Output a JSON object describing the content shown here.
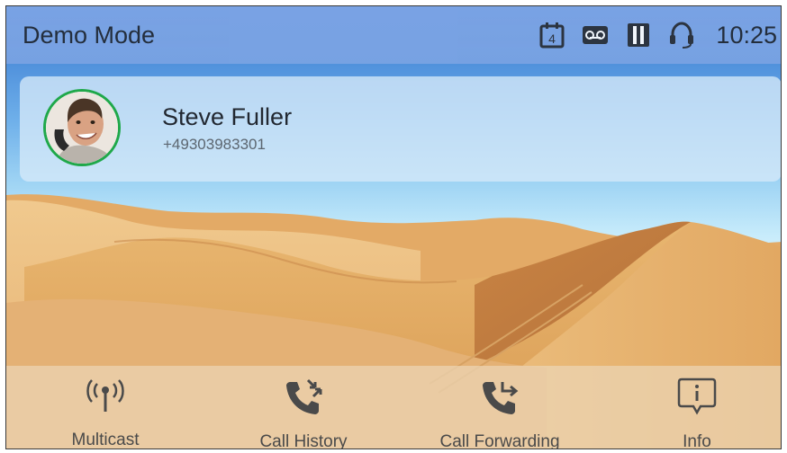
{
  "statusbar": {
    "title": "Demo Mode",
    "clock": "10:25",
    "calendar_day": "4",
    "icons": [
      "calendar-icon",
      "voicemail-icon",
      "sd-card-icon",
      "headset-icon"
    ]
  },
  "contact": {
    "name": "Steve Fuller",
    "number": "+49303983301"
  },
  "bottombar": {
    "items": [
      {
        "label": "Multicast",
        "icon": "multicast-icon"
      },
      {
        "label": "Call History",
        "icon": "call-history-icon"
      },
      {
        "label": "Call Forwarding",
        "icon": "call-forwarding-icon"
      },
      {
        "label": "Info",
        "icon": "info-icon"
      }
    ]
  },
  "colors": {
    "avatar_ring": "#1fa84a",
    "statusbar": "#7fa6e6",
    "icon_dark": "#2b2f36",
    "bottom_icon": "#4a4a4a"
  }
}
